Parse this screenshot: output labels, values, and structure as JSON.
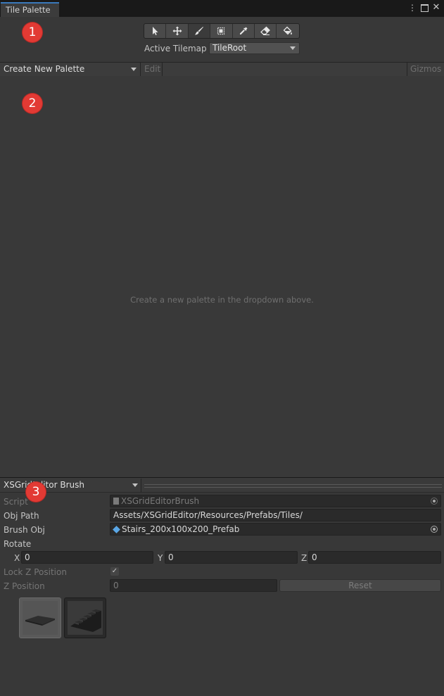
{
  "window": {
    "tab_title": "Tile Palette",
    "menu_icon": "kebab-menu-icon",
    "maximize_icon": "maximize-icon",
    "close_icon": "close-icon"
  },
  "toolbar": {
    "tools": [
      {
        "name": "select-tool-icon",
        "active": false
      },
      {
        "name": "move-tool-icon",
        "active": false
      },
      {
        "name": "paintbrush-tool-icon",
        "active": true
      },
      {
        "name": "box-fill-tool-icon",
        "active": false
      },
      {
        "name": "picker-tool-icon",
        "active": false
      },
      {
        "name": "eraser-tool-icon",
        "active": false
      },
      {
        "name": "flood-fill-tool-icon",
        "active": false
      }
    ],
    "active_tilemap_label": "Active Tilemap",
    "active_tilemap_value": "TileRoot"
  },
  "palette_bar": {
    "palette_dropdown": "Create New Palette",
    "edit_label": "Edit",
    "gizmos_label": "Gizmos"
  },
  "palette_area": {
    "empty_message": "Create a new palette in the dropdown above."
  },
  "markers": [
    "1",
    "2",
    "3"
  ],
  "brush": {
    "brush_dropdown": "XSGridEditor Brush",
    "script_label": "Script",
    "script_value": "XSGridEditorBrush",
    "obj_path_label": "Obj Path",
    "obj_path_value": "Assets/XSGridEditor/Resources/Prefabs/Tiles/",
    "brush_obj_label": "Brush Obj",
    "brush_obj_value": "Stairs_200x100x200_Prefab",
    "rotate_label": "Rotate",
    "x_label": "X",
    "x_value": "0",
    "y_label": "Y",
    "y_value": "0",
    "z_label": "Z",
    "z_value": "0",
    "lock_z_label": "Lock Z Position",
    "lock_z_checked": true,
    "z_position_label": "Z Position",
    "z_position_value": "0",
    "reset_label": "Reset",
    "thumbnails": [
      "flat-tile-thumbnail",
      "stairs-tile-thumbnail"
    ]
  },
  "colors": {
    "background": "#383838",
    "titlebar": "#191919",
    "tab_accent": "#3a79bb",
    "marker": "#e23a34",
    "prefab_icon": "#5aa7e6"
  }
}
